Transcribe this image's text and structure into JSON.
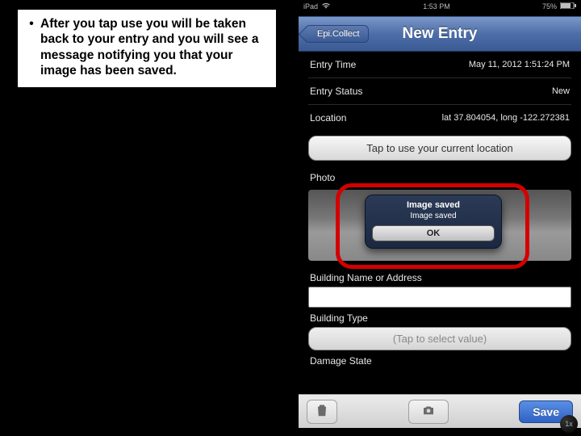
{
  "instruction": {
    "bullet": "•",
    "text": "After you tap use you will be taken back to your entry and you will see a message notifying you that your image has been saved."
  },
  "status": {
    "carrier": "iPad",
    "wifi": "●",
    "time": "1:53 PM",
    "battery_pct": "75%"
  },
  "navbar": {
    "back_label": "Epi.Collect",
    "title": "New Entry"
  },
  "fields": {
    "entry_time": {
      "label": "Entry Time",
      "value": "May 11, 2012 1:51:24 PM"
    },
    "entry_status": {
      "label": "Entry Status",
      "value": "New"
    },
    "location": {
      "label": "Location",
      "value": "lat 37.804054, long -122.272381"
    },
    "use_location_btn": "Tap to use your current location",
    "photo_label": "Photo",
    "building_name_label": "Building Name or Address",
    "building_type_label": "Building Type",
    "building_type_placeholder": "(Tap to select value)",
    "damage_state_label": "Damage State"
  },
  "alert": {
    "title": "Image saved",
    "message": "Image saved",
    "ok": "OK"
  },
  "toolbar": {
    "save_label": "Save"
  },
  "zoom": "1x"
}
